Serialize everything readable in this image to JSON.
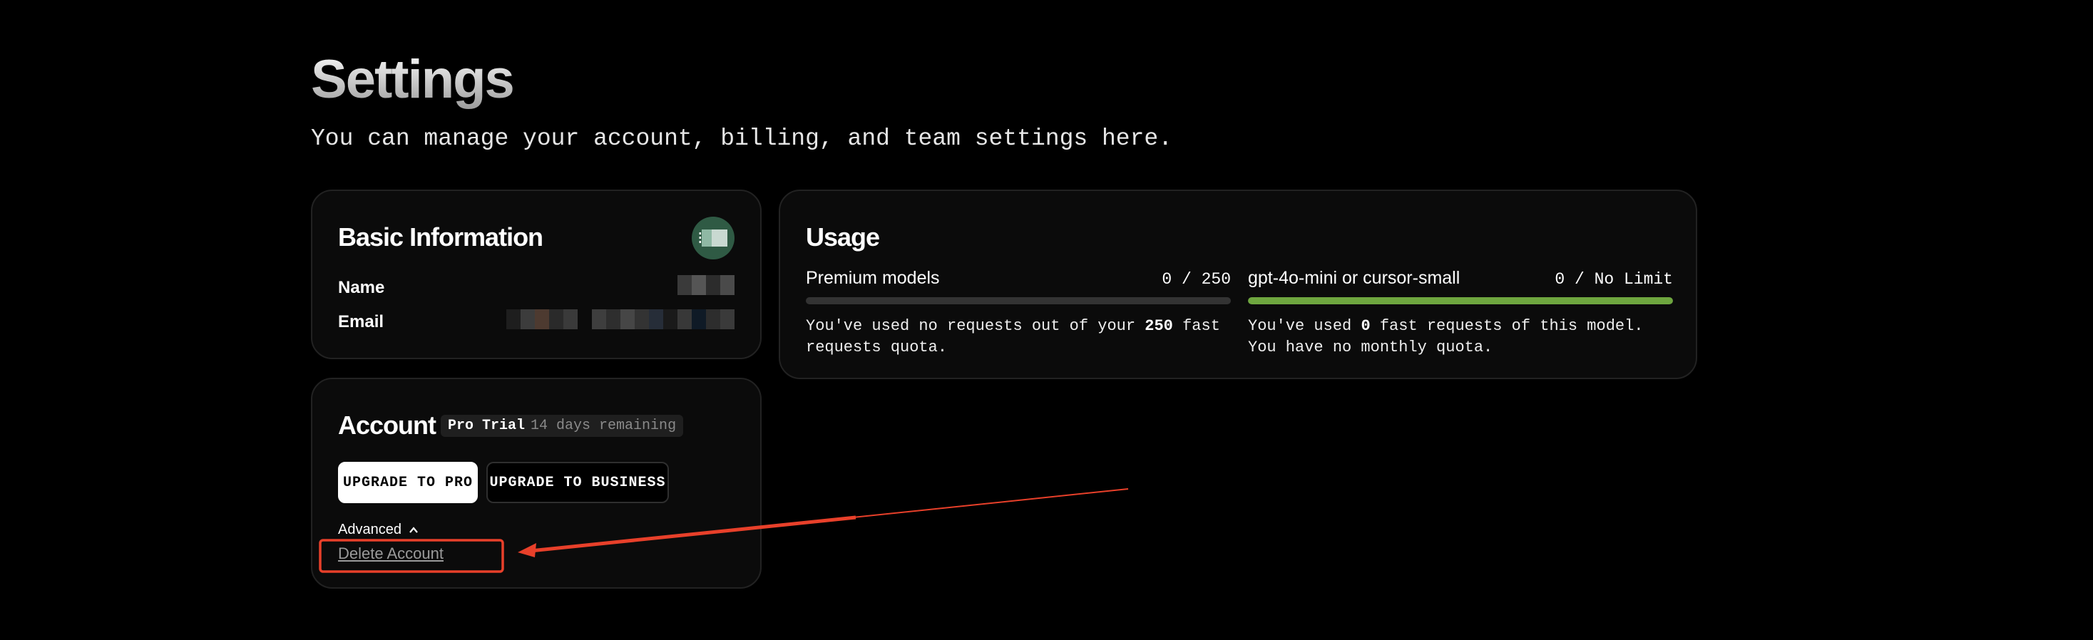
{
  "page": {
    "title": "Settings",
    "subtitle": "You can manage your account, billing, and team settings here."
  },
  "basic_info": {
    "title": "Basic Information",
    "name_label": "Name",
    "email_label": "Email"
  },
  "account": {
    "title": "Account",
    "plan_name": "Pro Trial",
    "plan_remaining": "14 days remaining",
    "upgrade_pro_label": "UPGRADE TO PRO",
    "upgrade_business_label": "UPGRADE TO BUSINESS",
    "advanced_label": "Advanced",
    "delete_label": "Delete Account"
  },
  "usage": {
    "title": "Usage",
    "premium": {
      "label": "Premium models",
      "count": "0 / 250",
      "progress": 0,
      "note_before": "You've used no requests out of your ",
      "note_bold": "250",
      "note_after": " fast requests quota."
    },
    "small": {
      "label": "gpt-4o-mini or cursor-small",
      "count": "0 / No Limit",
      "progress": 1,
      "note_before": "You've used ",
      "note_bold": "0",
      "note_after": " fast requests of this model. You have no monthly quota."
    }
  },
  "colors": {
    "background": "#000000",
    "card": "#0b0b0b",
    "progress_green": "#6ea63f",
    "annotation_red": "#e8402a"
  }
}
